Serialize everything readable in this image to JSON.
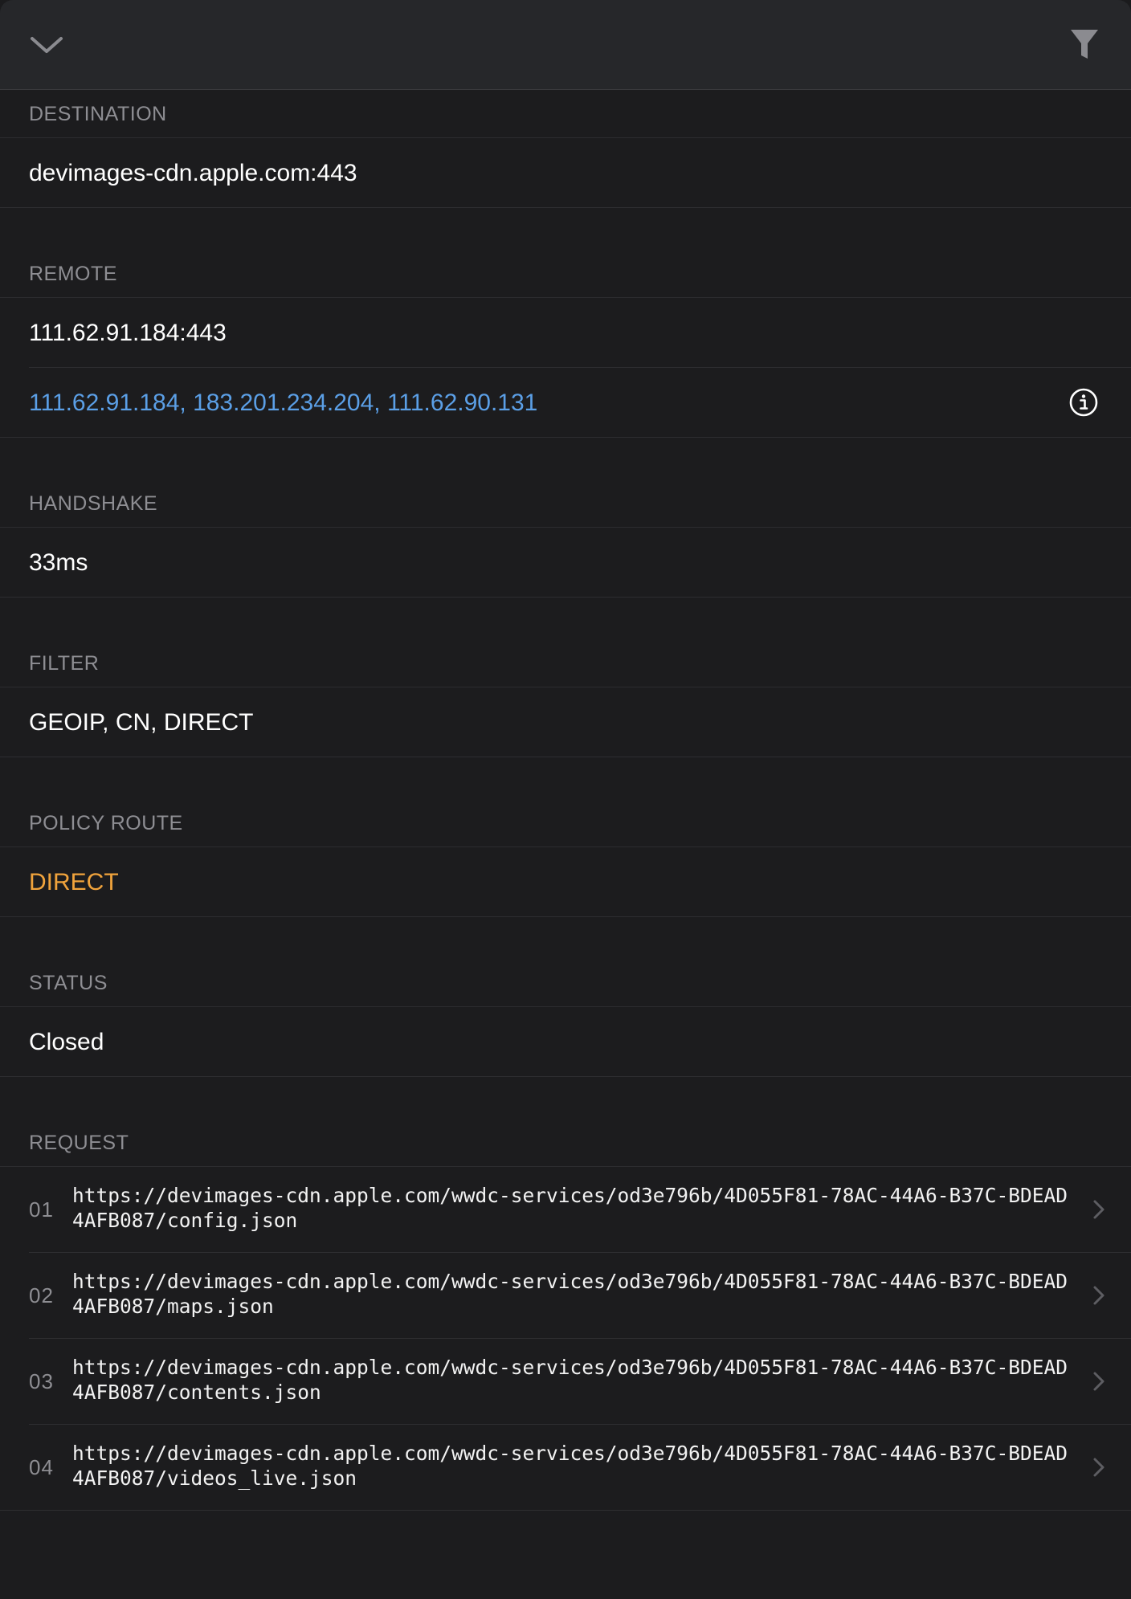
{
  "toolbar": {
    "collapse_icon": "chevron-down-icon",
    "filter_icon": "filter-icon"
  },
  "destination": {
    "header": "DESTINATION",
    "value": "devimages-cdn.apple.com:443"
  },
  "remote": {
    "header": "REMOTE",
    "address": "111.62.91.184:443",
    "resolved": "111.62.91.184, 183.201.234.204, 111.62.90.131",
    "info_icon": "info-circle-icon"
  },
  "handshake": {
    "header": "HANDSHAKE",
    "value": "33ms"
  },
  "filter": {
    "header": "FILTER",
    "value": "GEOIP, CN, DIRECT"
  },
  "policy_route": {
    "header": "POLICY ROUTE",
    "value": "DIRECT"
  },
  "status": {
    "header": "STATUS",
    "value": "Closed"
  },
  "request": {
    "header": "REQUEST",
    "items": [
      {
        "index": "01",
        "url": "https://devimages-cdn.apple.com/wwdc-services/od3e796b/4D055F81-78AC-44A6-B37C-BDEAD4AFB087/config.json"
      },
      {
        "index": "02",
        "url": "https://devimages-cdn.apple.com/wwdc-services/od3e796b/4D055F81-78AC-44A6-B37C-BDEAD4AFB087/maps.json"
      },
      {
        "index": "03",
        "url": "https://devimages-cdn.apple.com/wwdc-services/od3e796b/4D055F81-78AC-44A6-B37C-BDEAD4AFB087/contents.json"
      },
      {
        "index": "04",
        "url": "https://devimages-cdn.apple.com/wwdc-services/od3e796b/4D055F81-78AC-44A6-B37C-BDEAD4AFB087/videos_live.json"
      }
    ]
  },
  "colors": {
    "background": "#1c1c1e",
    "toolbar": "#26272a",
    "link": "#5b9fe6",
    "accent_orange": "#f0a33c",
    "secondary_text": "#8e8e93"
  }
}
